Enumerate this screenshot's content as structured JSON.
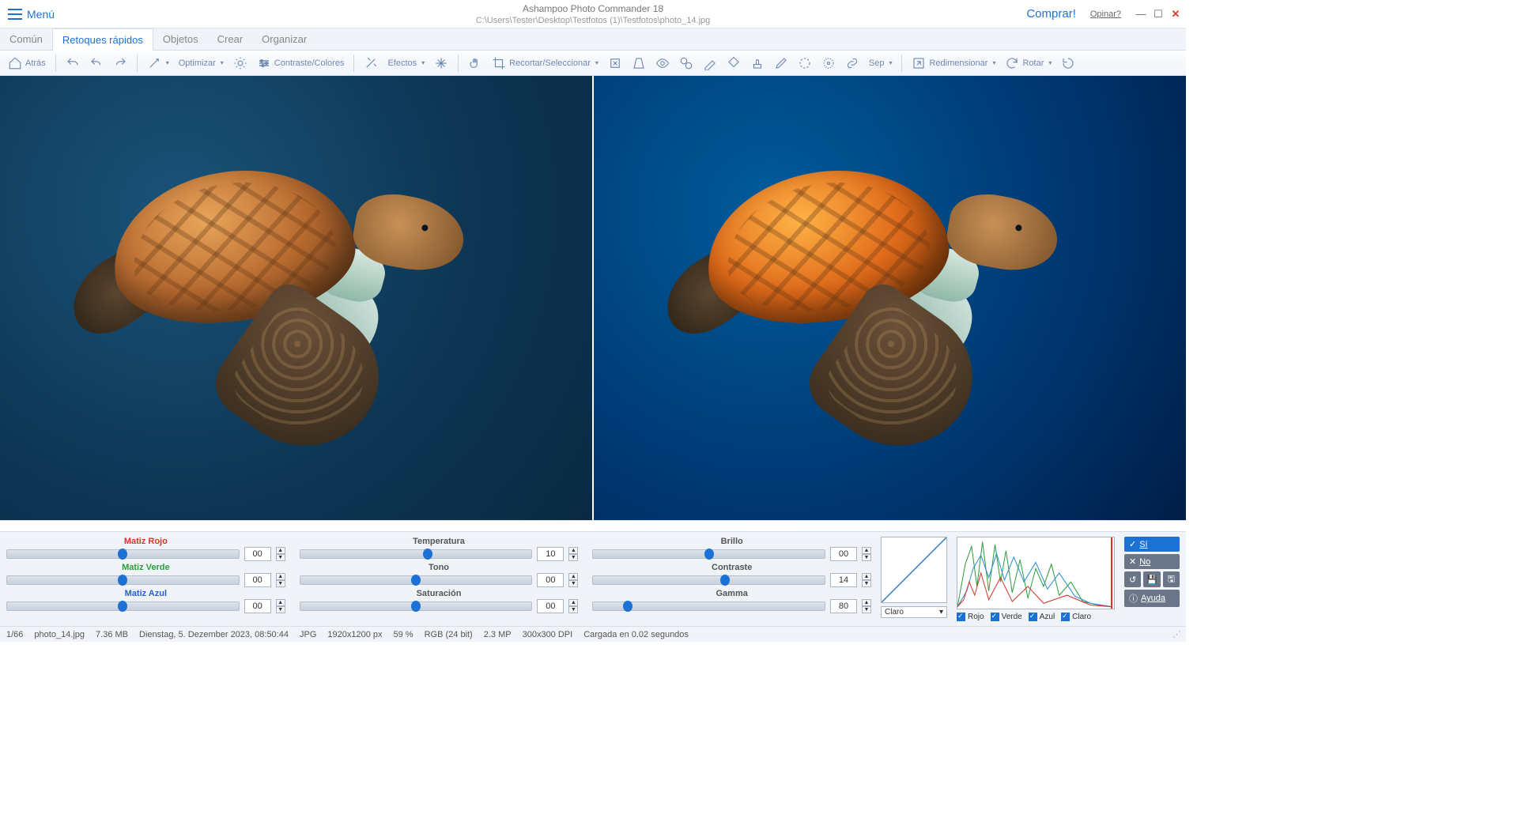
{
  "titlebar": {
    "menu": "Menú",
    "appname": "Ashampoo Photo Commander 18",
    "path": "C:\\Users\\Tester\\Desktop\\Testfotos (1)\\Testfotos\\photo_14.jpg",
    "comprar": "Comprar!",
    "opinar": "Opinar?"
  },
  "tabs": [
    "Común",
    "Retoques rápidos",
    "Objetos",
    "Crear",
    "Organizar"
  ],
  "active_tab": 1,
  "toolbar": {
    "atras": "Atrás",
    "optimizar": "Optimizar",
    "contraste": "Contraste/Colores",
    "efectos": "Efectos",
    "recortar": "Recortar/Seleccionar",
    "sep": "Sep",
    "redimensionar": "Redimensionar",
    "rotar": "Rotar"
  },
  "sliders": {
    "col1": [
      {
        "label": "Matiz Rojo",
        "cls": "red",
        "val": "00",
        "pos": 50
      },
      {
        "label": "Matiz Verde",
        "cls": "green",
        "val": "00",
        "pos": 50
      },
      {
        "label": "Matiz Azul",
        "cls": "blue",
        "val": "00",
        "pos": 50
      }
    ],
    "col2": [
      {
        "label": "Temperatura",
        "cls": "norm",
        "val": "10",
        "pos": 55
      },
      {
        "label": "Tono",
        "cls": "norm",
        "val": "00",
        "pos": 50
      },
      {
        "label": "Saturación",
        "cls": "norm",
        "val": "00",
        "pos": 50
      }
    ],
    "col3": [
      {
        "label": "Brillo",
        "cls": "norm",
        "val": "00",
        "pos": 50
      },
      {
        "label": "Contraste",
        "cls": "norm",
        "val": "14",
        "pos": 57
      },
      {
        "label": "Gamma",
        "cls": "norm",
        "val": "80",
        "pos": 15
      }
    ]
  },
  "histo": {
    "claro_label": "Claro",
    "channels": [
      "Rojo",
      "Verde",
      "Azul",
      "Claro"
    ]
  },
  "buttons": {
    "yes": "Sí",
    "no": "No",
    "ayuda": "Ayuda"
  },
  "status": {
    "idx": "1/66",
    "file": "photo_14.jpg",
    "size": "7.36 MB",
    "date": "Dienstag, 5. Dezember 2023, 08:50:44",
    "fmt": "JPG",
    "dim": "1920x1200 px",
    "zoom": "59 %",
    "rgb": "RGB (24 bit)",
    "mp": "2.3 MP",
    "dpi": "300x300 DPI",
    "loaded": "Cargada en 0.02 segundos"
  }
}
